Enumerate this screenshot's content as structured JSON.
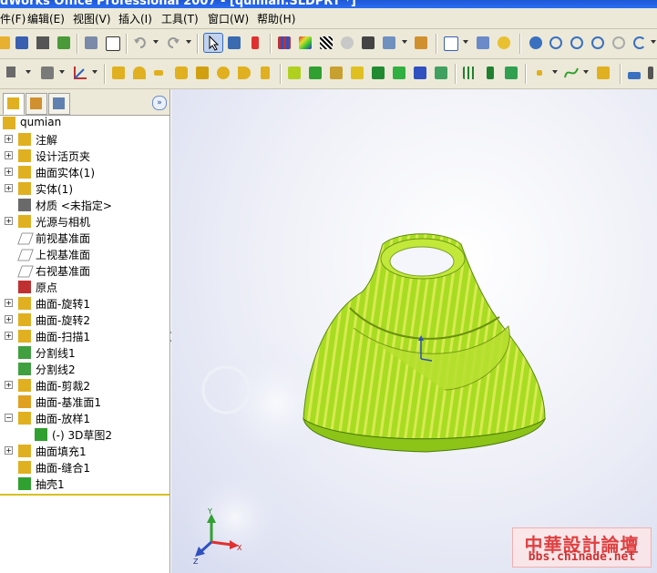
{
  "window": {
    "title": "dWorks Office Professional 2007 - [qumian.SLDPRT *]"
  },
  "menu": [
    "件(F)",
    "编辑(E)",
    "视图(V)",
    "插入(I)",
    "工具(T)",
    "窗口(W)",
    "帮助(H)"
  ],
  "feature_manager": {
    "root": "qumian",
    "items": [
      {
        "label": "注解",
        "expander": "+",
        "icon": "annotations-icon"
      },
      {
        "label": "设计活页夹",
        "expander": "+",
        "icon": "design-binder-icon"
      },
      {
        "label": "曲面实体(1)",
        "expander": "+",
        "icon": "surface-bodies-icon"
      },
      {
        "label": "实体(1)",
        "expander": "+",
        "icon": "solid-bodies-icon"
      },
      {
        "label": "材质 <未指定>",
        "expander": "",
        "icon": "material-icon"
      },
      {
        "label": "光源与相机",
        "expander": "+",
        "icon": "lights-cameras-icon"
      },
      {
        "label": "前视基准面",
        "expander": "",
        "icon": "plane-icon"
      },
      {
        "label": "上视基准面",
        "expander": "",
        "icon": "plane-icon"
      },
      {
        "label": "右视基准面",
        "expander": "",
        "icon": "plane-icon"
      },
      {
        "label": "原点",
        "expander": "",
        "icon": "origin-icon"
      },
      {
        "label": "曲面-旋转1",
        "expander": "+",
        "icon": "surface-revolve-icon"
      },
      {
        "label": "曲面-旋转2",
        "expander": "+",
        "icon": "surface-revolve-icon"
      },
      {
        "label": "曲面-扫描1",
        "expander": "+",
        "icon": "surface-sweep-icon"
      },
      {
        "label": "分割线1",
        "expander": "",
        "icon": "split-line-icon"
      },
      {
        "label": "分割线2",
        "expander": "",
        "icon": "split-line-icon"
      },
      {
        "label": "曲面-剪裁2",
        "expander": "+",
        "icon": "surface-trim-icon"
      },
      {
        "label": "曲面-基准面1",
        "expander": "",
        "icon": "planar-surface-icon"
      },
      {
        "label": "曲面-放样1",
        "expander": "-",
        "icon": "surface-loft-icon"
      },
      {
        "label": "(-) 3D草图2",
        "expander": "",
        "icon": "sketch3d-icon",
        "indent": true
      },
      {
        "label": "曲面填充1",
        "expander": "+",
        "icon": "fill-surface-icon"
      },
      {
        "label": "曲面-缝合1",
        "expander": "",
        "icon": "knit-surface-icon"
      },
      {
        "label": "抽壳1",
        "expander": "",
        "icon": "shell-icon"
      }
    ]
  },
  "triad": {
    "x": "X",
    "y": "Y",
    "z": "Z"
  },
  "watermark": {
    "line1": "中華設計論壇",
    "line2": "bbs.chinade.net"
  },
  "colors": {
    "model_green": "#a8e02a",
    "model_stripe": "#d8ea50",
    "menu_bg": "#ece9d8",
    "selection": "#316ac5"
  }
}
